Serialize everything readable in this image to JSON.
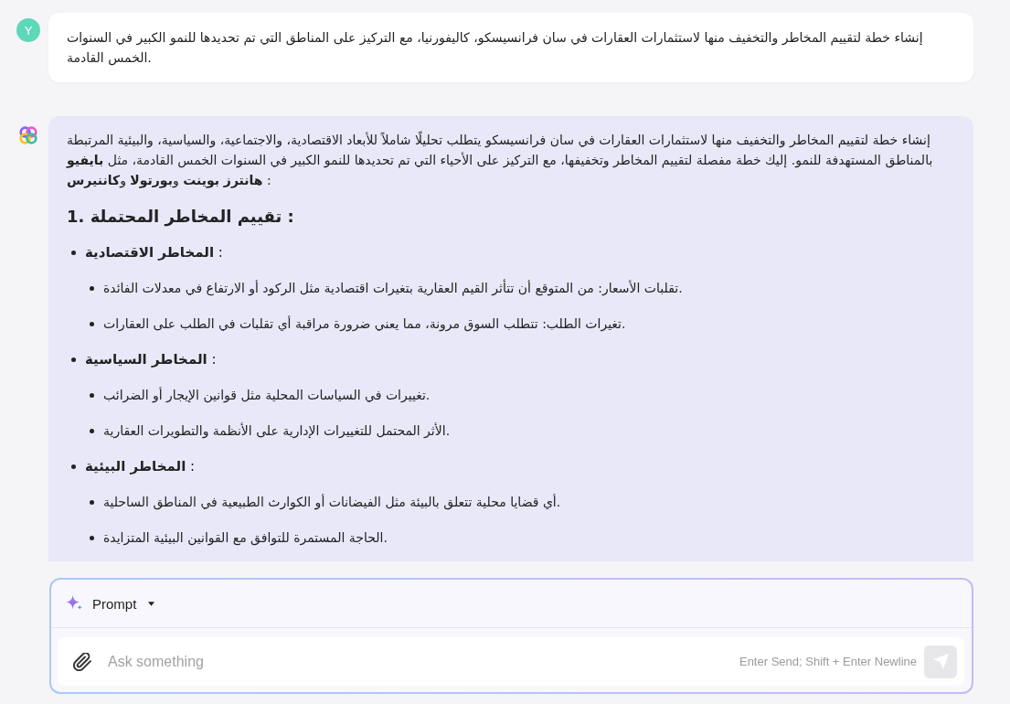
{
  "messages": [
    {
      "kind": "user",
      "avatar": "Y",
      "text": "إنشاء خطة لتقييم المخاطر والتخفيف منها لاستثمارات العقارات في سان فرانسيسكو، كاليفورنيا، مع التركيز على المناطق التي تم تحديدها للنمو الكبير في السنوات الخمس القادمة."
    },
    {
      "kind": "assistant",
      "intro": "إنشاء خطة لتقييم المخاطر والتخفيف منها لاستثمارات العقارات في سان فرانسيسكو يتطلب تحليلًا شاملاً للأبعاد الاقتصادية، والاجتماعية، والسياسية، والبيئية المرتبطة بالمناطق المستهدفة للنمو. إليك خطة مفصلة لتقييم المخاطر وتخفيفها، مع التركيز على الأحياء التي تم تحديدها للنمو الكبير في السنوات الخمس القادمة، مثل **بايفيو هانترز بوينت** و**بورتولا** و**كاننيرس** :",
      "heading": "1. تقييم المخاطر المحتملة :",
      "sections": [
        {
          "title": "**المخاطر الاقتصادية** :",
          "items": [
            "تقلبات الأسعار: من المتوقع أن تتأثر القيم العقارية بتغيرات اقتصادية مثل الركود أو الارتفاع في معدلات الفائدة.",
            "تغيرات الطلب: تتطلب السوق مرونة، مما يعني ضرورة مراقبة أي تقلبات في الطلب على العقارات."
          ]
        },
        {
          "title": "**المخاطر السياسية** :",
          "items": [
            "تغييرات في السياسات المحلية مثل قوانين الإيجار أو الضرائب.",
            "الأثر المحتمل للتغييرات الإدارية على الأنظمة والتطويرات العقارية."
          ]
        },
        {
          "title": "**المخاطر البيئية** :",
          "items": [
            "أي قضايا محلية تتعلق بالبيئة مثل الفيضانات أو الكوارث الطبيعية في المناطق الساحلية.",
            "الحاجة المستمرة للتوافق مع القوانين البيئية المتزايدة."
          ]
        }
      ]
    }
  ],
  "composer": {
    "mode": "Prompt",
    "placeholder": "Ask something",
    "hint": "Enter Send; Shift + Enter Newline",
    "send_button": {
      "disabled": true
    }
  }
}
